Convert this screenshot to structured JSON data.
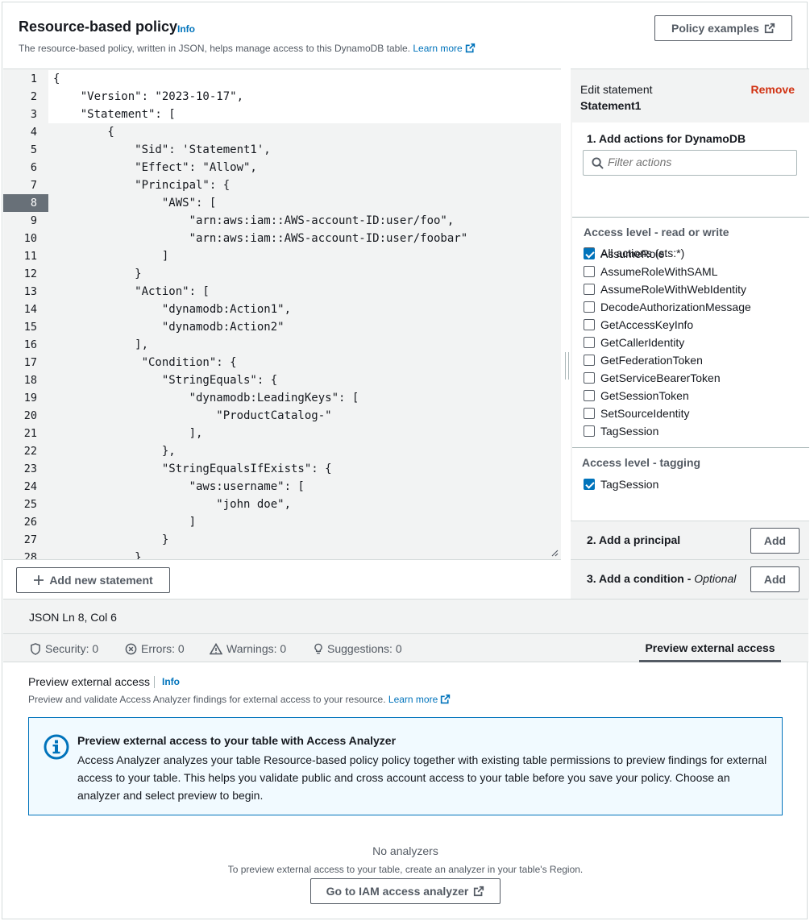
{
  "header": {
    "title": "Resource-based policy",
    "info": "Info",
    "description": "The resource-based policy, written in JSON, helps manage access to this DynamoDB table.",
    "learn_more": "Learn more",
    "policy_examples": "Policy examples"
  },
  "editor": {
    "active_line": 8,
    "lines": [
      "{",
      "    \"Version\": \"2023-10-17\",",
      "    \"Statement\": [",
      "        {",
      "            \"Sid\": 'Statement1',",
      "            \"Effect\": \"Allow\",",
      "            \"Principal\": {",
      "                \"AWS\": [",
      "                    \"arn:aws:iam::AWS-account-ID:user/foo\",",
      "                    \"arn:aws:iam::AWS-account-ID:user/foobar\"",
      "                ]",
      "            }",
      "            \"Action\": [",
      "                \"dynamodb:Action1\",",
      "                \"dynamodb:Action2\"",
      "            ],",
      "             \"Condition\": {",
      "                \"StringEquals\": {",
      "                    \"dynamodb:LeadingKeys\": [",
      "                        \"ProductCatalog-\"",
      "                    ],",
      "                },",
      "                \"StringEqualsIfExists\": {",
      "                    \"aws:username\": [",
      "                        \"john doe\",",
      "                    ]",
      "                }",
      "            }"
    ],
    "add_statement": "Add new statement"
  },
  "panel": {
    "edit_statement": "Edit statement",
    "statement_name": "Statement1",
    "remove": "Remove",
    "step1": "1. Add actions for DynamoDB",
    "filter_placeholder": "Filter actions",
    "all_actions": "All actions (sts:*)",
    "rw_heading": "Access level - read or write",
    "rw_actions": [
      {
        "label": "AssumeRole",
        "checked": true
      },
      {
        "label": "AssumeRoleWithSAML",
        "checked": false
      },
      {
        "label": "AssumeRoleWithWebIdentity",
        "checked": false
      },
      {
        "label": "DecodeAuthorizationMessage",
        "checked": false
      },
      {
        "label": "GetAccessKeyInfo",
        "checked": false
      },
      {
        "label": "GetCallerIdentity",
        "checked": false
      },
      {
        "label": "GetFederationToken",
        "checked": false
      },
      {
        "label": "GetServiceBearerToken",
        "checked": false
      },
      {
        "label": "GetSessionToken",
        "checked": false
      },
      {
        "label": "SetSourceIdentity",
        "checked": false
      },
      {
        "label": "TagSession",
        "checked": false
      }
    ],
    "tagging_heading": "Access level - tagging",
    "tagging_actions": [
      {
        "label": "TagSession",
        "checked": true
      }
    ],
    "step2": "2. Add a principal",
    "step3": "3. Add a condition -",
    "step3_optional": "Optional",
    "add": "Add"
  },
  "status": {
    "position": "JSON Ln 8, Col 6",
    "security": "Security: 0",
    "errors": "Errors: 0",
    "warnings": "Warnings: 0",
    "suggestions": "Suggestions: 0",
    "preview_tab": "Preview external access"
  },
  "preview": {
    "title": "Preview external access",
    "info": "Info",
    "description": "Preview and validate Access Analyzer findings for external access to your resource.",
    "learn_more": "Learn more",
    "alert_title": "Preview external access to your table with Access Analyzer",
    "alert_body": "Access Analyzer analyzes your table Resource-based policy policy together with existing table permissions to preview findings for external access to your table. This helps you validate public and cross account access to your table before you save your policy. Choose an analyzer and select preview to begin.",
    "no_analyzers": "No analyzers",
    "no_analyzers_desc": "To preview external access to your table, create an analyzer in your table's Region.",
    "go_iam": "Go to IAM access analyzer"
  }
}
